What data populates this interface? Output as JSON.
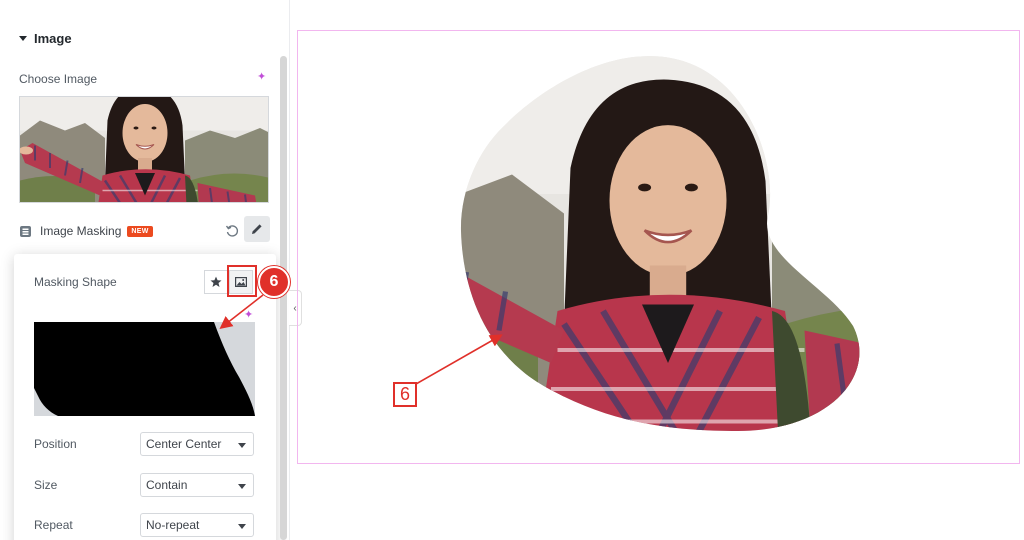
{
  "panel": {
    "section_title": "Image",
    "choose_image_label": "Choose Image",
    "image_masking": {
      "label": "Image Masking",
      "badge": "NEW"
    }
  },
  "popover": {
    "masking_shape_label": "Masking Shape",
    "fields": [
      {
        "label": "Position",
        "value": "Center Center"
      },
      {
        "label": "Size",
        "value": "Contain"
      },
      {
        "label": "Repeat",
        "value": "No-repeat"
      }
    ]
  },
  "annotations": {
    "step_number": "6",
    "step_label": "6"
  },
  "colors": {
    "accent_red": "#e0302a",
    "new_badge": "#ec4a1f",
    "ai_sparkle": "#c14fd8",
    "canvas_border": "#f2b6ef"
  },
  "icons": {
    "ai_sparkle": "sparkle-icon",
    "masking": "masking-icon",
    "reset": "reset-icon",
    "edit": "pencil-icon",
    "star_shape": "star-icon",
    "image_shape": "image-icon",
    "collapse": "chevron-left-icon"
  }
}
